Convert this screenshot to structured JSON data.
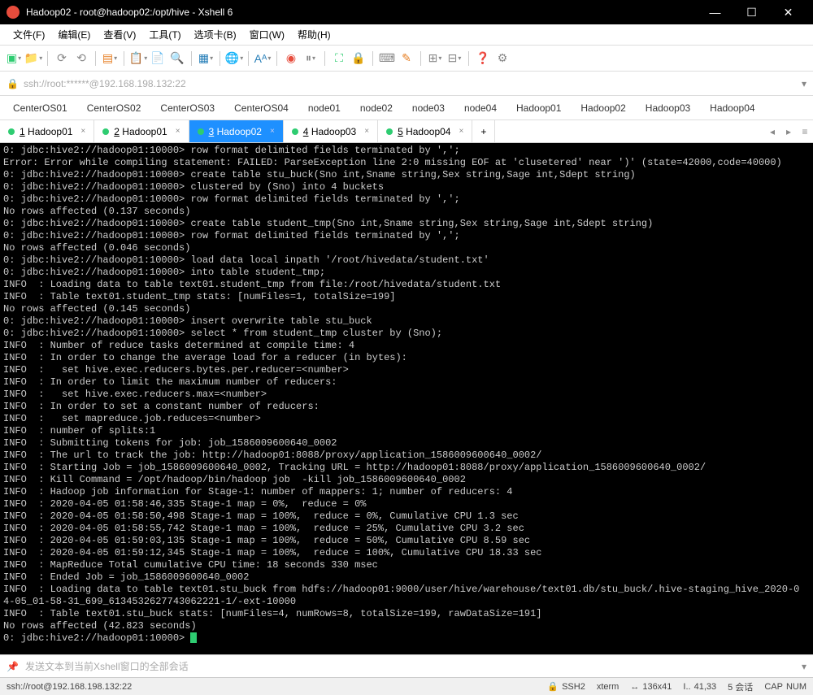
{
  "titlebar": {
    "title": "Hadoop02 - root@hadoop02:/opt/hive - Xshell 6"
  },
  "menus": [
    "文件(F)",
    "编辑(E)",
    "查看(V)",
    "工具(T)",
    "选项卡(B)",
    "窗口(W)",
    "帮助(H)"
  ],
  "address": "ssh://root:******@192.168.198.132:22",
  "bookmarks": [
    "CenterOS01",
    "CenterOS02",
    "CenterOS03",
    "CenterOS04",
    "node01",
    "node02",
    "node03",
    "node04",
    "Hadoop01",
    "Hadoop02",
    "Hadoop03",
    "Hadoop04"
  ],
  "tabs": [
    {
      "num": "1",
      "label": "Hadoop01",
      "active": false
    },
    {
      "num": "2",
      "label": "Hadoop01",
      "active": false
    },
    {
      "num": "3",
      "label": "Hadoop02",
      "active": true
    },
    {
      "num": "4",
      "label": "Hadoop03",
      "active": false
    },
    {
      "num": "5",
      "label": "Hadoop04",
      "active": false
    }
  ],
  "terminal_lines": [
    "0: jdbc:hive2://hadoop01:10000> row format delimited fields terminated by ',';",
    "Error: Error while compiling statement: FAILED: ParseException line 2:0 missing EOF at 'clusetered' near ')' (state=42000,code=40000)",
    "0: jdbc:hive2://hadoop01:10000> create table stu_buck(Sno int,Sname string,Sex string,Sage int,Sdept string)",
    "0: jdbc:hive2://hadoop01:10000> clustered by (Sno) into 4 buckets",
    "0: jdbc:hive2://hadoop01:10000> row format delimited fields terminated by ',';",
    "No rows affected (0.137 seconds)",
    "0: jdbc:hive2://hadoop01:10000> create table student_tmp(Sno int,Sname string,Sex string,Sage int,Sdept string)",
    "0: jdbc:hive2://hadoop01:10000> row format delimited fields terminated by ',';",
    "No rows affected (0.046 seconds)",
    "0: jdbc:hive2://hadoop01:10000> load data local inpath '/root/hivedata/student.txt'",
    "0: jdbc:hive2://hadoop01:10000> into table student_tmp;",
    "INFO  : Loading data to table text01.student_tmp from file:/root/hivedata/student.txt",
    "INFO  : Table text01.student_tmp stats: [numFiles=1, totalSize=199]",
    "No rows affected (0.145 seconds)",
    "0: jdbc:hive2://hadoop01:10000> insert overwrite table stu_buck",
    "0: jdbc:hive2://hadoop01:10000> select * from student_tmp cluster by (Sno);",
    "INFO  : Number of reduce tasks determined at compile time: 4",
    "INFO  : In order to change the average load for a reducer (in bytes):",
    "INFO  :   set hive.exec.reducers.bytes.per.reducer=<number>",
    "INFO  : In order to limit the maximum number of reducers:",
    "INFO  :   set hive.exec.reducers.max=<number>",
    "INFO  : In order to set a constant number of reducers:",
    "INFO  :   set mapreduce.job.reduces=<number>",
    "INFO  : number of splits:1",
    "INFO  : Submitting tokens for job: job_1586009600640_0002",
    "INFO  : The url to track the job: http://hadoop01:8088/proxy/application_1586009600640_0002/",
    "INFO  : Starting Job = job_1586009600640_0002, Tracking URL = http://hadoop01:8088/proxy/application_1586009600640_0002/",
    "INFO  : Kill Command = /opt/hadoop/bin/hadoop job  -kill job_1586009600640_0002",
    "INFO  : Hadoop job information for Stage-1: number of mappers: 1; number of reducers: 4",
    "INFO  : 2020-04-05 01:58:46,335 Stage-1 map = 0%,  reduce = 0%",
    "INFO  : 2020-04-05 01:58:50,498 Stage-1 map = 100%,  reduce = 0%, Cumulative CPU 1.3 sec",
    "INFO  : 2020-04-05 01:58:55,742 Stage-1 map = 100%,  reduce = 25%, Cumulative CPU 3.2 sec",
    "INFO  : 2020-04-05 01:59:03,135 Stage-1 map = 100%,  reduce = 50%, Cumulative CPU 8.59 sec",
    "INFO  : 2020-04-05 01:59:12,345 Stage-1 map = 100%,  reduce = 100%, Cumulative CPU 18.33 sec",
    "INFO  : MapReduce Total cumulative CPU time: 18 seconds 330 msec",
    "INFO  : Ended Job = job_1586009600640_0002",
    "INFO  : Loading data to table text01.stu_buck from hdfs://hadoop01:9000/user/hive/warehouse/text01.db/stu_buck/.hive-staging_hive_2020-0",
    "4-05_01-58-31_699_6134532627743062221-1/-ext-10000",
    "INFO  : Table text01.stu_buck stats: [numFiles=4, numRows=8, totalSize=199, rawDataSize=191]",
    "No rows affected (42.823 seconds)",
    "0: jdbc:hive2://hadoop01:10000> "
  ],
  "compose_placeholder": "发送文本到当前Xshell窗口的全部会话",
  "statusbar": {
    "conn": "ssh://root@192.168.198.132:22",
    "proto": "SSH2",
    "term": "xterm",
    "size": "136x41",
    "pos": "41,33",
    "sessions": "5 会话",
    "cap": "CAP",
    "num": "NUM"
  }
}
